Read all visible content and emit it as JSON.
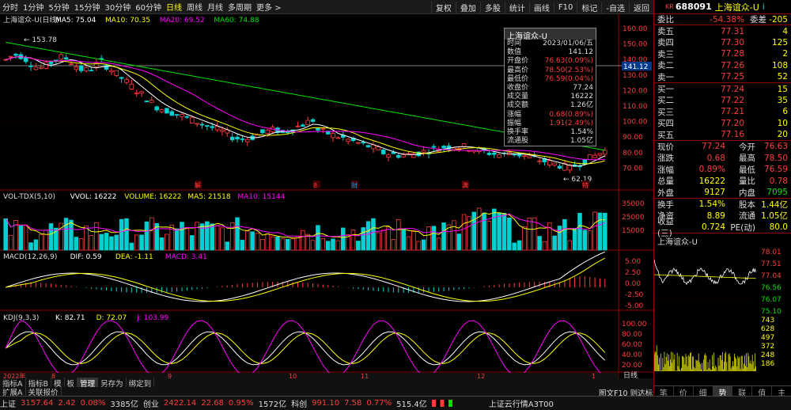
{
  "toolbar": {
    "periods": [
      "分时",
      "1分钟",
      "5分钟",
      "15分钟",
      "30分钟",
      "60分钟",
      "日线",
      "周线",
      "月线",
      "多周期",
      "更多 >"
    ],
    "active_period": "日线",
    "right_buttons": [
      "复权",
      "叠加",
      "多股",
      "统计",
      "画线",
      "F10",
      "标记",
      "-自选",
      "返回"
    ]
  },
  "main_chart": {
    "title": "上海谊众-U(日线)",
    "ma": [
      {
        "label": "MA5: 75.04",
        "color": "#ffffff"
      },
      {
        "label": "MA10: 70.35",
        "color": "#ffff00"
      },
      {
        "label": "MA20: 69.52",
        "color": "#ff00ff"
      },
      {
        "label": "MA60: 74.88",
        "color": "#00e000"
      }
    ],
    "price_axis": [
      "160.00",
      "150.00",
      "140.00",
      "130.00",
      "120.00",
      "110.00",
      "100.00",
      "90.00",
      "80.00",
      "70.00"
    ],
    "current_price_tag": "141.12",
    "high_label": "153.78",
    "low_label": "62.19",
    "event_markers": [
      "解",
      "8",
      "财",
      "满",
      "特"
    ],
    "x_axis": [
      "2022年",
      "8",
      "9",
      "10",
      "11",
      "12",
      "1"
    ]
  },
  "info_popup": {
    "title": "上海谊众-U",
    "rows": [
      {
        "k": "时间",
        "v": "2023/01/06/五"
      },
      {
        "k": "数值",
        "v": "141.12"
      },
      {
        "k": "开盘价",
        "v": "76.63(0.09%)"
      },
      {
        "k": "最高价",
        "v": "78.50(2.53%)"
      },
      {
        "k": "最低价",
        "v": "76.59(0.04%)"
      },
      {
        "k": "收盘价",
        "v": "77.24"
      },
      {
        "k": "成交量",
        "v": "16222"
      },
      {
        "k": "成交额",
        "v": "1.26亿"
      },
      {
        "k": "涨幅",
        "v": "0.68(0.89%)"
      },
      {
        "k": "振幅",
        "v": "1.91(2.49%)"
      },
      {
        "k": "换手率",
        "v": "1.54%"
      },
      {
        "k": "流通股",
        "v": "1.05亿"
      }
    ]
  },
  "volume_panel": {
    "title": "VOL-TDX(5,10)",
    "labels": [
      {
        "t": "VVOL: 16222",
        "c": "#ffffff"
      },
      {
        "t": "VOLUME: 16222",
        "c": "#ffff00"
      },
      {
        "t": "MA5: 21518",
        "c": "#ffff00"
      },
      {
        "t": "MA10: 15144",
        "c": "#ff00ff"
      }
    ],
    "axis": [
      "35000",
      "25000",
      "15000"
    ]
  },
  "macd_panel": {
    "title": "MACD(12,26,9)",
    "labels": [
      {
        "t": "DIF: 0.59",
        "c": "#ffffff"
      },
      {
        "t": "DEA: -1.11",
        "c": "#ffff00"
      },
      {
        "t": "MACD: 3.41",
        "c": "#ff00ff"
      }
    ],
    "axis": [
      "5.00",
      "2.50",
      "0.00",
      "-2.50",
      "-5.00"
    ]
  },
  "kdj_panel": {
    "title": "KDJ(9,3,3)",
    "labels": [
      {
        "t": "K: 82.71",
        "c": "#ffffff"
      },
      {
        "t": "D: 72.07",
        "c": "#ffff00"
      },
      {
        "t": "J: 103.99",
        "c": "#ff00ff"
      }
    ],
    "axis": [
      "100.00",
      "80.00",
      "60.00",
      "40.00",
      "20.00"
    ]
  },
  "tabs_row1": [
    "指标A",
    "指标B",
    "模",
    "板",
    "管理",
    "另存为",
    "绑定到"
  ],
  "tabs_row2": [
    "扩展A",
    "关联报价"
  ],
  "stock": {
    "code": "688091",
    "name": "上海谊众-U",
    "badge": "KR",
    "webi": "-54.38%",
    "weicha": "-205",
    "asks": [
      {
        "l": "卖五",
        "p": "77.31",
        "v": "4"
      },
      {
        "l": "卖四",
        "p": "77.30",
        "v": "125"
      },
      {
        "l": "卖三",
        "p": "77.28",
        "v": "2"
      },
      {
        "l": "卖二",
        "p": "77.26",
        "v": "108"
      },
      {
        "l": "卖一",
        "p": "77.25",
        "v": "52"
      }
    ],
    "bids": [
      {
        "l": "买一",
        "p": "77.24",
        "v": "15"
      },
      {
        "l": "买二",
        "p": "77.22",
        "v": "35"
      },
      {
        "l": "买三",
        "p": "77.21",
        "v": "6"
      },
      {
        "l": "买四",
        "p": "77.20",
        "v": "10"
      },
      {
        "l": "买五",
        "p": "77.16",
        "v": "20"
      }
    ],
    "quote": [
      {
        "a": "现价",
        "av": "77.24",
        "b": "今开",
        "bv": "76.63"
      },
      {
        "a": "涨跌",
        "av": "0.68",
        "b": "最高",
        "bv": "78.50"
      },
      {
        "a": "涨幅",
        "av": "0.89%",
        "b": "最低",
        "bv": "76.59"
      },
      {
        "a": "总量",
        "av": "16222",
        "b": "量比",
        "bv": "0.78"
      },
      {
        "a": "外盘",
        "av": "9127",
        "b": "内盘",
        "bv": "7095"
      }
    ],
    "extra": [
      {
        "a": "换手",
        "av": "1.54%",
        "b": "股本",
        "bv": "1.44亿"
      },
      {
        "a": "净资",
        "av": "8.89",
        "b": "流通",
        "bv": "1.05亿"
      },
      {
        "a": "收益(三)",
        "av": "0.724",
        "b": "PE(动)",
        "bv": "80.0"
      }
    ],
    "mini_title": "上海谊众-U",
    "mini_axis": [
      "78.01",
      "77.51",
      "77.04",
      "76.56",
      "76.07",
      "75.10",
      "743",
      "628",
      "497",
      "372",
      "248",
      "186"
    ],
    "bottom_tabs": [
      "笔",
      "价",
      "细",
      "势",
      "联",
      "值",
      "主"
    ],
    "bottom_left": "图文F10 则达标"
  },
  "statusbar": [
    {
      "t": "上证",
      "c": "#ddd"
    },
    {
      "t": "3157.64",
      "c": "#ff3c3c"
    },
    {
      "t": "2.42",
      "c": "#ff3c3c"
    },
    {
      "t": "0.08%",
      "c": "#ff3c3c"
    },
    {
      "t": "3385亿",
      "c": "#ddd"
    },
    {
      "t": "创业",
      "c": "#ddd"
    },
    {
      "t": "2422.14",
      "c": "#ff3c3c"
    },
    {
      "t": "22.68",
      "c": "#ff3c3c"
    },
    {
      "t": "0.95%",
      "c": "#ff3c3c"
    },
    {
      "t": "1572亿",
      "c": "#ddd"
    },
    {
      "t": "科创",
      "c": "#ddd"
    },
    {
      "t": "991.10",
      "c": "#ff3c3c"
    },
    {
      "t": "7.58",
      "c": "#ff3c3c"
    },
    {
      "t": "0.77%",
      "c": "#ff3c3c"
    },
    {
      "t": "515.4亿",
      "c": "#ddd"
    }
  ],
  "status_right": "上证云行情A3T00"
}
